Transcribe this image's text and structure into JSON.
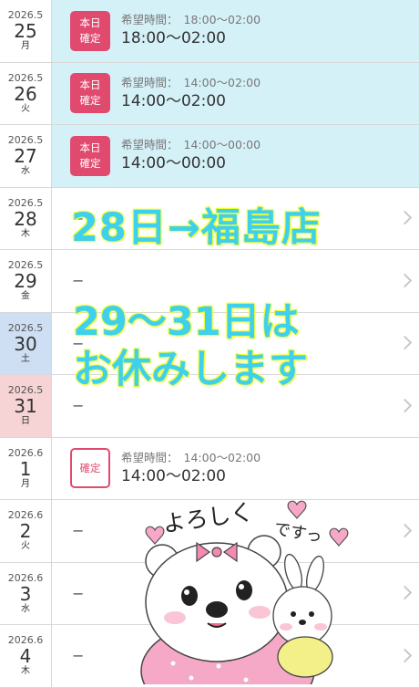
{
  "schedule": [
    {
      "year_month": "2026.5",
      "day": "25",
      "weekday": "月",
      "type": "filled",
      "badge_line1": "本日",
      "badge_line2": "確定",
      "label": "希望時間：",
      "hope_time": "18:00〜02:00",
      "main_time": "18:00〜02:00",
      "highlight": true
    },
    {
      "year_month": "2026.5",
      "day": "26",
      "weekday": "火",
      "type": "filled",
      "badge_line1": "本日",
      "badge_line2": "確定",
      "label": "希望時間：",
      "hope_time": "14:00〜02:00",
      "main_time": "14:00〜02:00",
      "highlight": true
    },
    {
      "year_month": "2026.5",
      "day": "27",
      "weekday": "水",
      "type": "filled",
      "badge_line1": "本日",
      "badge_line2": "確定",
      "label": "希望時間：",
      "hope_time": "14:00〜00:00",
      "main_time": "14:00〜00:00",
      "highlight": true
    },
    {
      "year_month": "2026.5",
      "day": "28",
      "weekday": "木",
      "type": "empty",
      "dash": "−"
    },
    {
      "year_month": "2026.5",
      "day": "29",
      "weekday": "金",
      "type": "empty",
      "dash": "−"
    },
    {
      "year_month": "2026.5",
      "day": "30",
      "weekday": "土",
      "type": "empty",
      "dash": "−",
      "date_bg": "sat"
    },
    {
      "year_month": "2026.5",
      "day": "31",
      "weekday": "日",
      "type": "empty",
      "dash": "−",
      "date_bg": "sun"
    },
    {
      "year_month": "2026.6",
      "day": "1",
      "weekday": "月",
      "type": "outline",
      "badge_line1": "確定",
      "badge_line2": "",
      "label": "希望時間：",
      "hope_time": "14:00〜02:00",
      "main_time": "14:00〜02:00",
      "highlight": false
    },
    {
      "year_month": "2026.6",
      "day": "2",
      "weekday": "火",
      "type": "empty",
      "dash": "−"
    },
    {
      "year_month": "2026.6",
      "day": "3",
      "weekday": "水",
      "type": "empty",
      "dash": "−"
    },
    {
      "year_month": "2026.6",
      "day": "4",
      "weekday": "木",
      "type": "empty",
      "dash": "−"
    }
  ],
  "overlay": {
    "line1": "28日→福島店",
    "line2": "29〜31日は",
    "line3": "お休みします"
  },
  "sticker": {
    "text1": "よろしく",
    "text2": "ですっ"
  },
  "colors": {
    "badge": "#e14a6f",
    "highlight_row": "#d5f1f8",
    "saturday": "#cfdff3",
    "sunday": "#f6d3d5",
    "overlay_text": "#3fd0ee",
    "overlay_stroke": "#e9ff2a"
  }
}
